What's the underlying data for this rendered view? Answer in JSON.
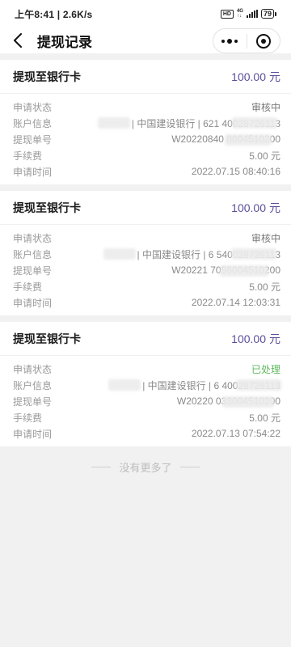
{
  "status_bar": {
    "time_speed": "上午8:41 | 2.6K/s",
    "hd_badge": "HD",
    "net_top": "4G",
    "net_bottom": "↑↓",
    "battery": "79"
  },
  "nav": {
    "title": "提现记录"
  },
  "labels": {
    "status": "申请状态",
    "account": "账户信息",
    "order_no": "提现单号",
    "fee": "手续费",
    "time": "申请时间"
  },
  "records": [
    {
      "title": "提现至银行卡",
      "amount": "100.00",
      "unit": "元",
      "status": "审核中",
      "account": "| 中国建设银行 | 621        40028726113",
      "order_no": "W20220840          8004510200",
      "fee": "5.00 元",
      "time": "2022.07.15 08:40:16"
    },
    {
      "title": "提现至银行卡",
      "amount": "100.00",
      "unit": "元",
      "status": "审核中",
      "account": "| 中国建设银行 | 6        540028726113",
      "order_no": "W20221          7056004510200",
      "fee": "5.00 元",
      "time": "2022.07.14 12:03:31"
    },
    {
      "title": "提现至银行卡",
      "amount": "100.00",
      "unit": "元",
      "status": "已处理",
      "account": "| 中国建设银行 | 6        40028726113",
      "order_no": "W20220          033004510200",
      "fee": "5.00 元",
      "time": "2022.07.13 07:54:22"
    }
  ],
  "footer": {
    "no_more": "没有更多了"
  },
  "colors": {
    "amount": "#5b4f9c",
    "done": "#5cb85c",
    "background": "#f1f1f1"
  }
}
